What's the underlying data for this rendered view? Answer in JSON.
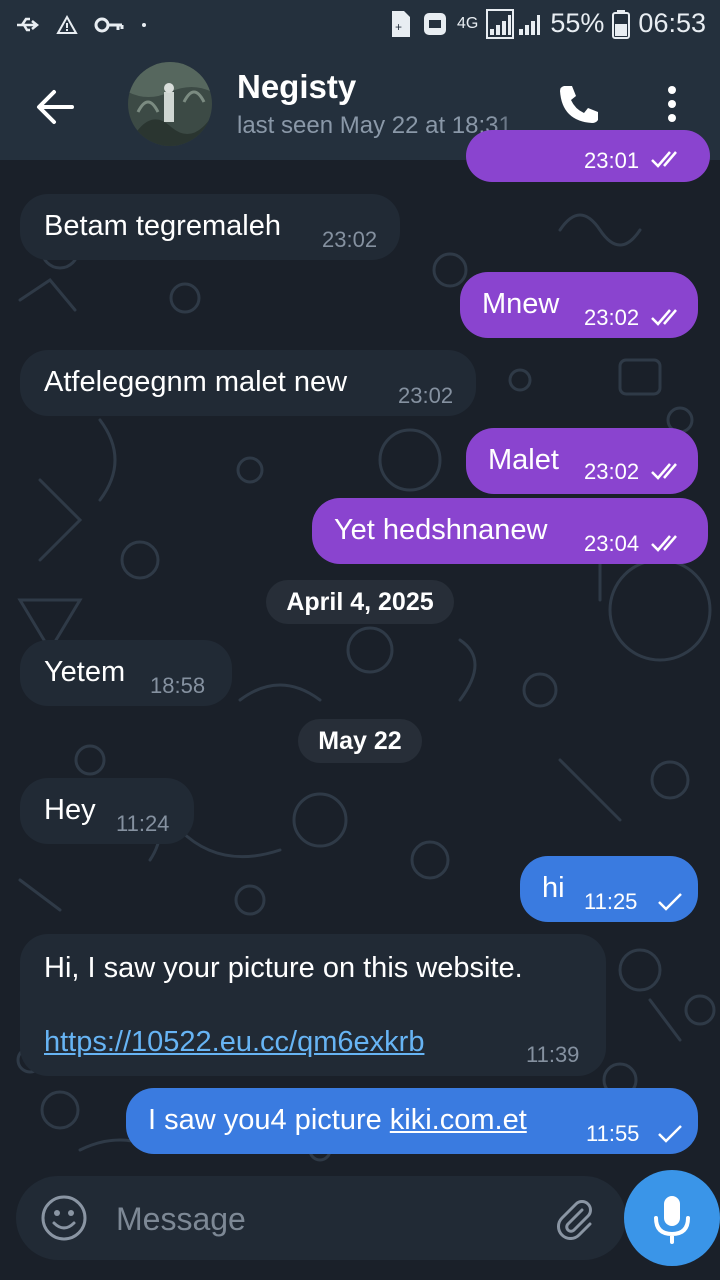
{
  "status_bar": {
    "network": "4G",
    "battery": "55%",
    "time": "06:53"
  },
  "header": {
    "contact_name": "Negisty",
    "last_seen": "last seen May 22 at 18:31"
  },
  "messages": [
    {
      "text": "Betam tegremaleh",
      "time": "23:02",
      "direction": "in"
    },
    {
      "text": "Mnew",
      "time": "23:02",
      "direction": "out",
      "status": "read"
    },
    {
      "text": "Atfelegegnm malet new",
      "time": "23:02",
      "direction": "in"
    },
    {
      "text": "Malet",
      "time": "23:02",
      "direction": "out",
      "status": "read"
    },
    {
      "text": "Yet hedshnanew",
      "time": "23:04",
      "direction": "out",
      "status": "read"
    },
    {
      "text": "Yetem",
      "time": "18:58",
      "direction": "in"
    },
    {
      "text": "Hey",
      "time": "11:24",
      "direction": "in"
    },
    {
      "text": "hi",
      "time": "11:25",
      "direction": "out",
      "status": "sent"
    },
    {
      "text": "Hi, I saw your picture on this website.",
      "link": "https://10522.eu.cc/qm6exkrb",
      "time": "11:39",
      "direction": "in"
    },
    {
      "text": "I saw you4 picture ",
      "link": "kiki.com.et",
      "time": "11:55",
      "direction": "out",
      "status": "sent"
    }
  ],
  "partial_top_message_time": "23:01",
  "dates": [
    "April 4, 2025",
    "May 22"
  ],
  "composer": {
    "placeholder": "Message"
  },
  "colors": {
    "header_bg": "#24303d",
    "incoming_bubble": "#212a35",
    "outgoing_purple": "#8a44cf",
    "outgoing_blue": "#3a7be0",
    "link": "#67b4f4",
    "mic_button": "#3a95e8"
  },
  "icons": [
    "back-arrow-icon",
    "phone-icon",
    "more-vert-icon",
    "emoji-icon",
    "attach-icon",
    "mic-icon",
    "double-check-icon",
    "single-check-icon"
  ]
}
